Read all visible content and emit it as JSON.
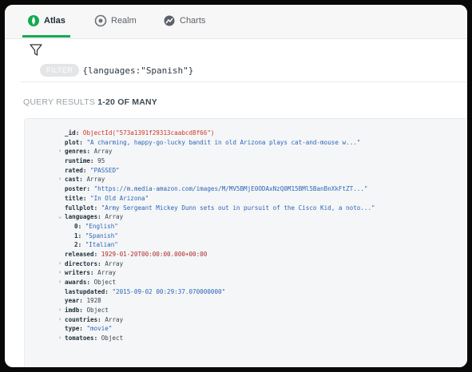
{
  "tabs": [
    {
      "label": "Atlas",
      "icon": "atlas-leaf-icon",
      "active": true
    },
    {
      "label": "Realm",
      "icon": "realm-icon",
      "active": false
    },
    {
      "label": "Charts",
      "icon": "charts-icon",
      "active": false
    }
  ],
  "filter": {
    "pill": "FILTER",
    "query": "{languages:\"Spanish\"}"
  },
  "results": {
    "label": "QUERY RESULTS",
    "range": "1-20 OF MANY"
  },
  "document": [
    {
      "key": "_id",
      "value": "ObjectId(\"573a1391f29313caabcd8f66\")",
      "vtype": "o",
      "caret": false,
      "nested": false
    },
    {
      "key": "plot",
      "value": "\"A charming, happy-go-lucky bandit in old Arizona plays cat-and-mouse w...\"",
      "vtype": "s",
      "caret": false,
      "nested": false
    },
    {
      "key": "genres",
      "value": "Array",
      "vtype": "v",
      "caret": true,
      "nested": false
    },
    {
      "key": "runtime",
      "value": "95",
      "vtype": "n",
      "caret": false,
      "nested": false
    },
    {
      "key": "rated",
      "value": "\"PASSED\"",
      "vtype": "s",
      "caret": false,
      "nested": false
    },
    {
      "key": "cast",
      "value": "Array",
      "vtype": "v",
      "caret": true,
      "nested": false
    },
    {
      "key": "poster",
      "value": "\"https://m.media-amazon.com/images/M/MV5BMjE0ODAxNzQ0M15BMl5BanBnXkFtZT...\"",
      "vtype": "s",
      "caret": false,
      "nested": false
    },
    {
      "key": "title",
      "value": "\"In Old Arizona\"",
      "vtype": "s",
      "caret": false,
      "nested": false
    },
    {
      "key": "fullplot",
      "value": "\"Army Sergeant Mickey Dunn sets out in pursuit of the Cisco Kid, a noto...\"",
      "vtype": "s",
      "caret": false,
      "nested": false
    },
    {
      "key": "languages",
      "value": "Array",
      "vtype": "v",
      "caret": "open",
      "nested": false
    },
    {
      "key": "0",
      "value": "\"English\"",
      "vtype": "s",
      "caret": false,
      "nested": true
    },
    {
      "key": "1",
      "value": "\"Spanish\"",
      "vtype": "s",
      "caret": false,
      "nested": true
    },
    {
      "key": "2",
      "value": "\"Italian\"",
      "vtype": "s",
      "caret": false,
      "nested": true
    },
    {
      "key": "released",
      "value": "1929-01-20T00:00:00.000+00:00",
      "vtype": "d",
      "caret": false,
      "nested": false
    },
    {
      "key": "directors",
      "value": "Array",
      "vtype": "v",
      "caret": true,
      "nested": false
    },
    {
      "key": "writers",
      "value": "Array",
      "vtype": "v",
      "caret": true,
      "nested": false
    },
    {
      "key": "awards",
      "value": "Object",
      "vtype": "v",
      "caret": true,
      "nested": false
    },
    {
      "key": "lastupdated",
      "value": "\"2015-09-02 00:29:37.070000000\"",
      "vtype": "s",
      "caret": false,
      "nested": false
    },
    {
      "key": "year",
      "value": "1928",
      "vtype": "n",
      "caret": false,
      "nested": false
    },
    {
      "key": "imdb",
      "value": "Object",
      "vtype": "v",
      "caret": true,
      "nested": false
    },
    {
      "key": "countries",
      "value": "Array",
      "vtype": "v",
      "caret": true,
      "nested": false
    },
    {
      "key": "type",
      "value": "\"movie\"",
      "vtype": "s",
      "caret": false,
      "nested": false
    },
    {
      "key": "tomatoes",
      "value": "Object",
      "vtype": "v",
      "caret": true,
      "nested": false
    }
  ],
  "colors": {
    "accent": "#13aa52",
    "string": "#2b66b9",
    "objectid": "#d0362b"
  }
}
